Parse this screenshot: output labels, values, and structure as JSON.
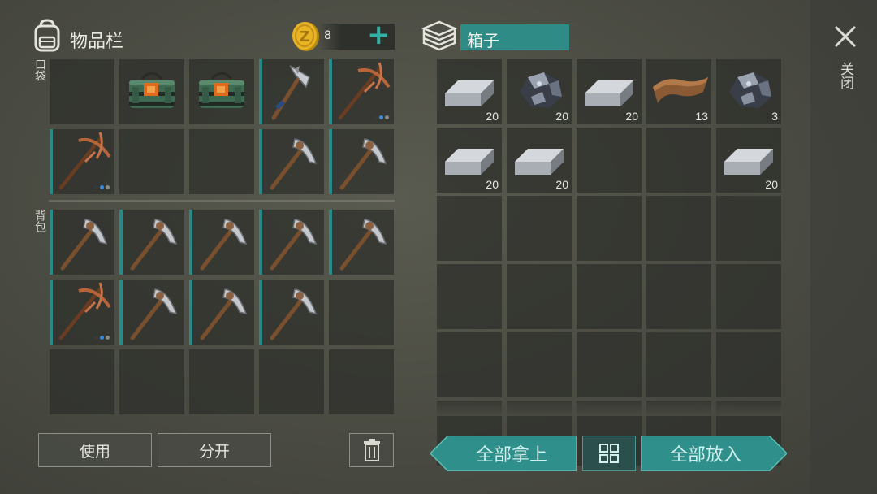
{
  "inventory": {
    "title": "物品栏",
    "pocket_label": "口袋",
    "backpack_label": "背包",
    "coins": "8",
    "add_label": "+",
    "pocket_slots": [
      {
        "item": "",
        "bar": false
      },
      {
        "item": "explosive-pack-icon",
        "bar": false
      },
      {
        "item": "explosive-pack-icon",
        "bar": false
      },
      {
        "item": "hatchet-icon",
        "bar": true
      },
      {
        "item": "copper-pickaxe-icon",
        "bar": true,
        "dots": true
      },
      {
        "item": "copper-pickaxe-icon",
        "bar": true,
        "dots": true
      },
      {
        "item": "",
        "bar": false
      },
      {
        "item": "",
        "bar": false
      },
      {
        "item": "stone-pickaxe-icon",
        "bar": true
      },
      {
        "item": "stone-pickaxe-icon",
        "bar": true
      }
    ],
    "backpack_slots": [
      {
        "item": "stone-pickaxe-icon",
        "bar": true
      },
      {
        "item": "stone-pickaxe-icon",
        "bar": true
      },
      {
        "item": "stone-pickaxe-icon",
        "bar": true
      },
      {
        "item": "stone-pickaxe-icon",
        "bar": true
      },
      {
        "item": "stone-pickaxe-icon",
        "bar": true
      },
      {
        "item": "copper-pickaxe-icon",
        "bar": true,
        "dots": true
      },
      {
        "item": "stone-pickaxe-icon",
        "bar": true
      },
      {
        "item": "stone-pickaxe-icon",
        "bar": true
      },
      {
        "item": "stone-pickaxe-icon",
        "bar": true
      },
      {
        "item": "",
        "bar": false
      },
      {
        "item": "",
        "bar": false
      },
      {
        "item": "",
        "bar": false
      },
      {
        "item": "",
        "bar": false
      },
      {
        "item": "",
        "bar": false
      },
      {
        "item": "",
        "bar": false
      }
    ],
    "use_label": "使用",
    "split_label": "分开"
  },
  "box": {
    "title": "箱子",
    "slots": [
      {
        "item": "iron-ingot-icon",
        "qty": "20"
      },
      {
        "item": "iron-ore-icon",
        "qty": "20"
      },
      {
        "item": "iron-ingot-icon",
        "qty": "20"
      },
      {
        "item": "leather-icon",
        "qty": "13"
      },
      {
        "item": "iron-ore-icon",
        "qty": "3"
      },
      {
        "item": "iron-ingot-icon",
        "qty": "20"
      },
      {
        "item": "iron-ingot-icon",
        "qty": "20"
      },
      {
        "item": "",
        "qty": ""
      },
      {
        "item": "",
        "qty": ""
      },
      {
        "item": "iron-ingot-icon",
        "qty": "20"
      }
    ],
    "take_all_label": "全部拿上",
    "put_all_label": "全部放入"
  },
  "close_label": "关闭",
  "colors": {
    "accent": "#2a8a8a",
    "teal_button": "#2f8f8a",
    "bar": "#2a8a8a"
  }
}
